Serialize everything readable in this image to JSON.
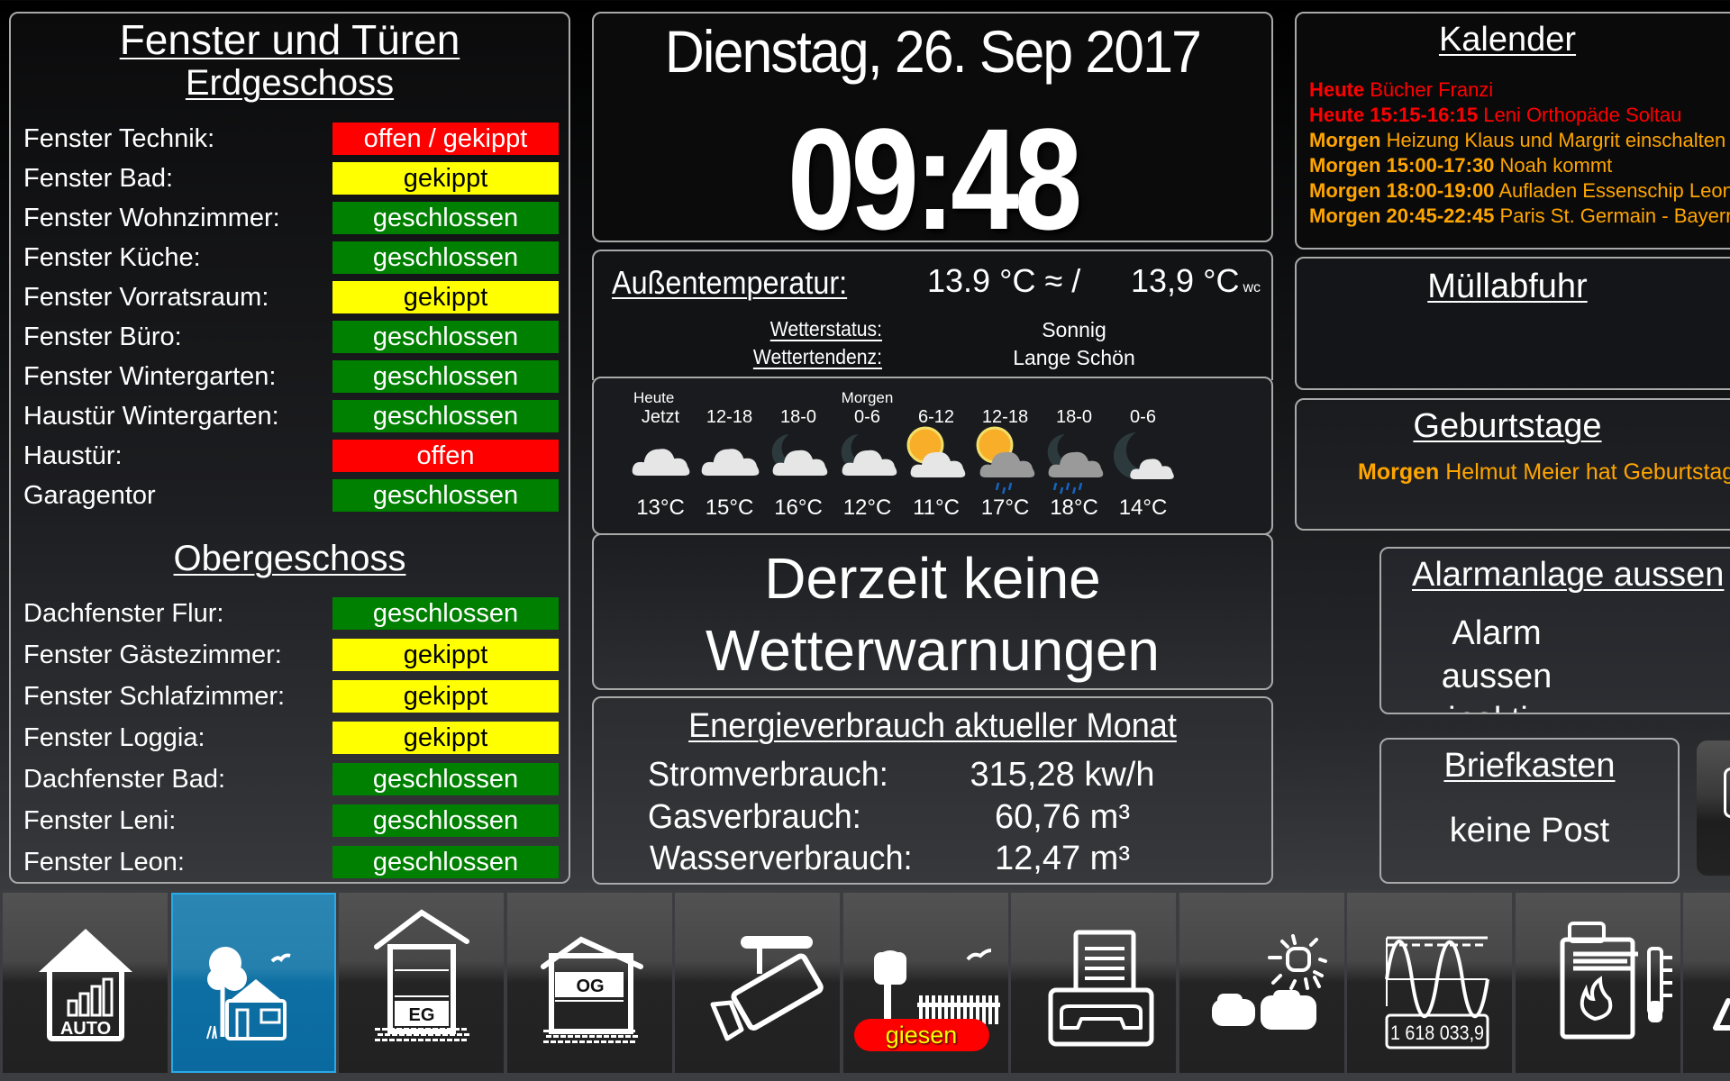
{
  "windows": {
    "title": "Fenster und Türen",
    "ground_floor": {
      "title": "Erdgeschoss",
      "items": [
        {
          "label": "Fenster Technik:",
          "status": "offen / gekippt",
          "color": "red"
        },
        {
          "label": "Fenster Bad:",
          "status": "gekippt",
          "color": "yellow"
        },
        {
          "label": "Fenster Wohnzimmer:",
          "status": "geschlossen",
          "color": "green"
        },
        {
          "label": "Fenster Küche:",
          "status": "geschlossen",
          "color": "green"
        },
        {
          "label": "Fenster Vorratsraum:",
          "status": "gekippt",
          "color": "yellow"
        },
        {
          "label": "Fenster Büro:",
          "status": "geschlossen",
          "color": "green"
        },
        {
          "label": "Fenster Wintergarten:",
          "status": "geschlossen",
          "color": "green"
        },
        {
          "label": "Haustür Wintergarten:",
          "status": "geschlossen",
          "color": "green"
        },
        {
          "label": "Haustür:",
          "status": "offen",
          "color": "red"
        },
        {
          "label": "Garagentor",
          "status": "geschlossen",
          "color": "green"
        }
      ]
    },
    "upper_floor": {
      "title": "Obergeschoss",
      "items": [
        {
          "label": "Dachfenster Flur:",
          "status": "geschlossen",
          "color": "green"
        },
        {
          "label": "Fenster Gästezimmer:",
          "status": "gekippt",
          "color": "yellow"
        },
        {
          "label": "Fenster Schlafzimmer:",
          "status": "gekippt",
          "color": "yellow"
        },
        {
          "label": "Fenster Loggia:",
          "status": "gekippt",
          "color": "yellow"
        },
        {
          "label": "Dachfenster Bad:",
          "status": "geschlossen",
          "color": "green"
        },
        {
          "label": "Fenster Leni:",
          "status": "geschlossen",
          "color": "green"
        },
        {
          "label": "Fenster Leon:",
          "status": "geschlossen",
          "color": "green"
        }
      ]
    },
    "status_colors": {
      "red": "#ff0000",
      "yellow": "#ffff00",
      "green": "#008000"
    }
  },
  "clock": {
    "date": "Dienstag, 26. Sep 2017",
    "time": "09:48"
  },
  "temperature": {
    "label": "Außentemperatur:",
    "value": "13.9 °C ≈ /",
    "windchill_value": "13,9 °C",
    "windchill_suffix": "wc",
    "status_label": "Wetterstatus:",
    "status_value": "Sonnig",
    "trend_label": "Wettertendenz:",
    "trend_value": "Lange Schön"
  },
  "forecast": [
    {
      "day": "Heute",
      "period": "Jetzt",
      "icon": "cloud-icon",
      "temp": "13°C"
    },
    {
      "day": "",
      "period": "12-18",
      "icon": "cloud-icon",
      "temp": "15°C"
    },
    {
      "day": "",
      "period": "18-0",
      "icon": "moon-cloud-icon",
      "temp": "16°C"
    },
    {
      "day": "Morgen",
      "period": "0-6",
      "icon": "moon-cloud-icon",
      "temp": "12°C"
    },
    {
      "day": "",
      "period": "6-12",
      "icon": "sun-cloud-icon",
      "temp": "11°C"
    },
    {
      "day": "",
      "period": "12-18",
      "icon": "sun-rain-cloud-icon",
      "temp": "17°C"
    },
    {
      "day": "",
      "period": "18-0",
      "icon": "moon-rain-cloud-icon",
      "temp": "18°C"
    },
    {
      "day": "",
      "period": "0-6",
      "icon": "moon-small-cloud-icon",
      "temp": "14°C"
    }
  ],
  "warning": {
    "line1": "Derzeit keine",
    "line2": "Wetterwarnungen"
  },
  "energy": {
    "title": "Energieverbrauch aktueller Monat",
    "rows": [
      {
        "label": "Stromverbrauch:",
        "value": "315,28 kw/h"
      },
      {
        "label": "Gasverbrauch:",
        "value": "60,76 m³"
      },
      {
        "label": "Wasserverbrauch:",
        "value": "12,47 m³"
      }
    ]
  },
  "calendar": {
    "title": "Kalender",
    "entries": [
      {
        "when": "Heute",
        "text": "Bücher Franzi",
        "color": "red"
      },
      {
        "when": "Heute 15:15-16:15",
        "text": "Leni Orthopäde Soltau",
        "color": "red"
      },
      {
        "when": "Morgen",
        "text": "Heizung Klaus und Margrit einschalten",
        "color": "orange"
      },
      {
        "when": "Morgen 15:00-17:30",
        "text": "Noah kommt",
        "color": "orange"
      },
      {
        "when": "Morgen 18:00-19:00",
        "text": "Aufladen Essenschip Leon",
        "color": "orange"
      },
      {
        "when": "Morgen 20:45-22:45",
        "text": "Paris St. Germain - Bayern",
        "color": "orange"
      }
    ],
    "colors": {
      "red": "#ff0000",
      "orange": "#ffa500"
    }
  },
  "garbage": {
    "title": "Müllabfuhr"
  },
  "birthdays": {
    "title": "Geburtstage",
    "when": "Morgen",
    "text": "Helmut Meier hat Geburtstag"
  },
  "alarm": {
    "title": "Alarmanlage aussen",
    "status": "Alarm aussen inaktiv"
  },
  "mailbox": {
    "title": "Briefkasten",
    "status": "keine Post"
  },
  "toolbar": {
    "active_index": 1,
    "items": [
      {
        "name": "auto-house",
        "icon": "house-auto-icon",
        "label": "AUTO"
      },
      {
        "name": "outdoor",
        "icon": "house-garden-icon",
        "label": ""
      },
      {
        "name": "ground-floor",
        "icon": "house-eg-icon",
        "label": "EG"
      },
      {
        "name": "upper-floor",
        "icon": "house-og-icon",
        "label": "OG"
      },
      {
        "name": "camera",
        "icon": "security-camera-icon",
        "label": ""
      },
      {
        "name": "garden",
        "icon": "garden-tree-fence-icon",
        "label": "giesen"
      },
      {
        "name": "fax-phone",
        "icon": "fax-phone-icon",
        "label": ""
      },
      {
        "name": "weather",
        "icon": "weather-sun-clouds-icon",
        "label": ""
      },
      {
        "name": "power-meter",
        "icon": "power-meter-icon",
        "label": "1 618 033,9"
      },
      {
        "name": "heating",
        "icon": "boiler-thermometer-icon",
        "label": ""
      },
      {
        "name": "warning",
        "icon": "warning-triangle-icon",
        "label": ""
      }
    ],
    "accent_color": "#1a7eb3"
  }
}
